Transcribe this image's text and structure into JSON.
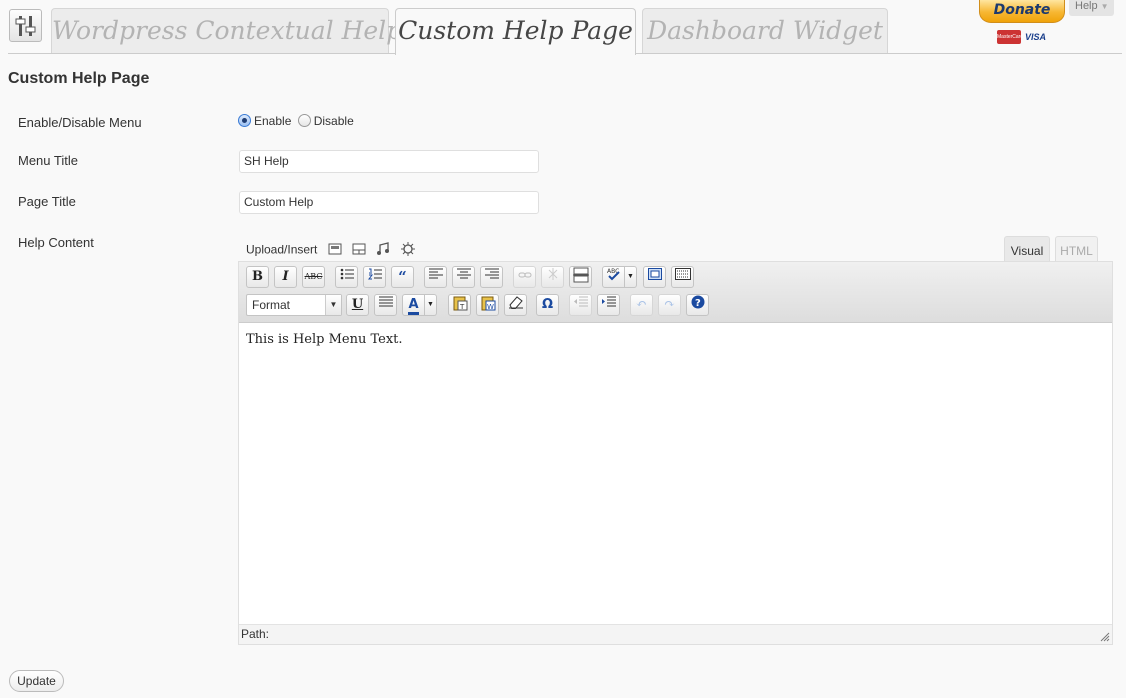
{
  "tabs": [
    {
      "label": "Wordpress Contextual Help",
      "active": false
    },
    {
      "label": "Custom Help Page",
      "active": true
    },
    {
      "label": "Dashboard Widget",
      "active": false
    }
  ],
  "donate": {
    "label": "Donate",
    "cards": [
      "MasterCard",
      "VISA"
    ]
  },
  "help_tab": {
    "label": "Help"
  },
  "page": {
    "section_title": "Custom Help Page"
  },
  "form": {
    "enable_label": "Enable/Disable Menu",
    "radio_enable": "Enable",
    "radio_disable": "Disable",
    "selected": "Enable",
    "menu_title_label": "Menu Title",
    "menu_title_value": "SH Help",
    "page_title_label": "Page Title",
    "page_title_value": "Custom Help",
    "help_content_label": "Help Content"
  },
  "editor": {
    "upload_label": "Upload/Insert",
    "tab_visual": "Visual",
    "tab_html": "HTML",
    "format_select": "Format",
    "content": "This is Help Menu Text.",
    "path_label": "Path:"
  },
  "actions": {
    "update_label": "Update"
  },
  "colors": {
    "accent": "#3a7bd5",
    "donate": "#f7b733"
  }
}
